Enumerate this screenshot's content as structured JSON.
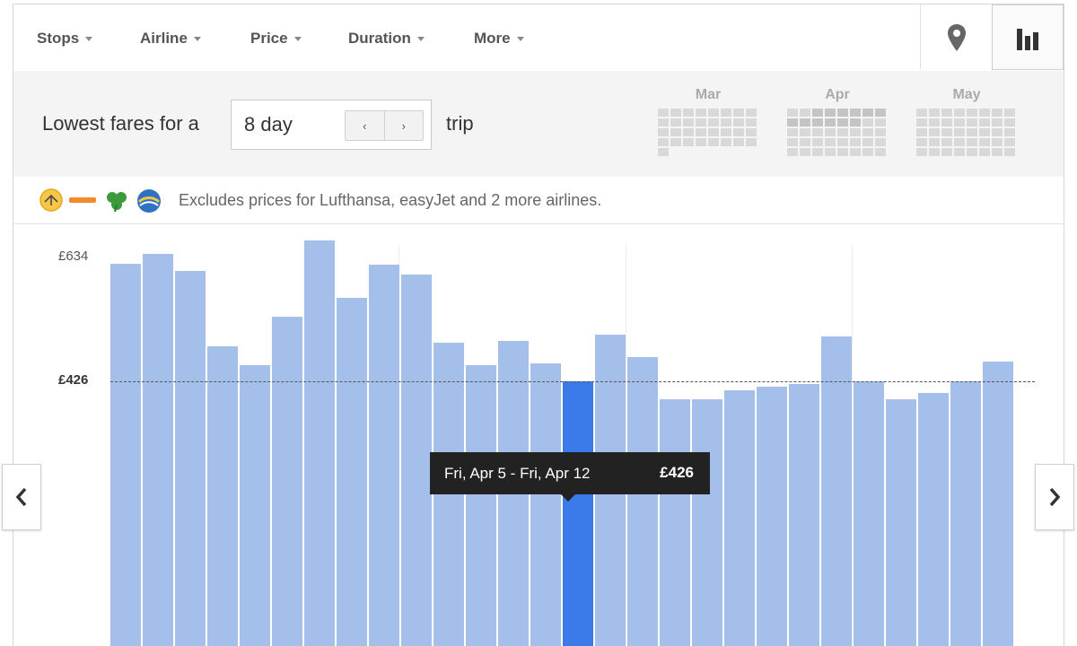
{
  "toolbar": {
    "filters": [
      {
        "label": "Stops"
      },
      {
        "label": "Airline"
      },
      {
        "label": "Price"
      },
      {
        "label": "Duration"
      },
      {
        "label": "More"
      }
    ],
    "map_icon": "map-pin-icon",
    "chart_icon": "bar-chart-icon"
  },
  "trip": {
    "prefix": "Lowest fares for a",
    "length_value": "8 day",
    "suffix": "trip",
    "decrease_glyph": "‹",
    "increase_glyph": "›"
  },
  "months": [
    {
      "label": "Mar"
    },
    {
      "label": "Apr"
    },
    {
      "label": "May"
    }
  ],
  "notice": {
    "text": "Excludes prices for Lufthansa, easyJet and 2 more airlines.",
    "icons": [
      "lufthansa-logo-icon",
      "easyjet-logo-icon",
      "aer-lingus-shamrock-icon",
      "airline-globe-logo-icon"
    ]
  },
  "colors": {
    "bar": "#a4bfe9",
    "bar_selected": "#3b7be9",
    "tooltip_bg": "#222222"
  },
  "chart_data": {
    "type": "bar",
    "y_tick_labels": [
      "£634",
      "£426"
    ],
    "reference_value": 426,
    "values": [
      609,
      624,
      598,
      480,
      451,
      526,
      645,
      556,
      607,
      592,
      486,
      451,
      488,
      453,
      426,
      499,
      464,
      398,
      398,
      412,
      417,
      422,
      496,
      426,
      398,
      408,
      426,
      456
    ],
    "selected_index": 14,
    "tooltip": {
      "dates": "Fri, Apr 5 - Fri, Apr 12",
      "price": "£426"
    }
  },
  "nav": {
    "prev_glyph": "‹",
    "next_glyph": "›"
  }
}
